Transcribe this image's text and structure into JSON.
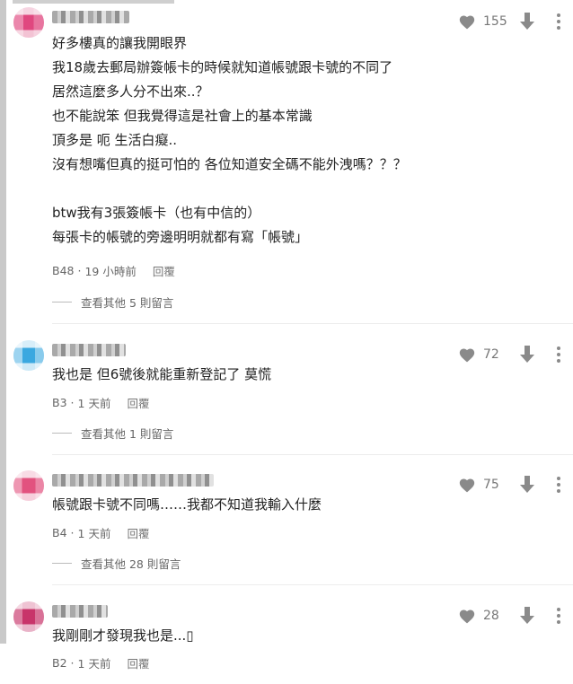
{
  "comments": [
    {
      "likes": "155",
      "lines": [
        "好多樓真的讓我開眼界",
        "我18歲去郵局辦簽帳卡的時候就知道帳號跟卡號的不同了",
        "居然這麼多人分不出來..？",
        "也不能說笨 但我覺得這是社會上的基本常識",
        "頂多是 呃 生活白癡..",
        "沒有想嘴但真的挺可怕的 各位知道安全碼不能外洩嗎？？？",
        "",
        "btw我有3張簽帳卡（也有中信的）",
        "每張卡的帳號的旁邊明明就都有寫「帳號」"
      ],
      "floor": "B48",
      "time": "19 小時前",
      "reply": "回覆",
      "view_more": "查看其他 5 則留言"
    },
    {
      "likes": "72",
      "lines": [
        "我也是 但6號後就能重新登記了 莫慌"
      ],
      "floor": "B3",
      "time": "1 天前",
      "reply": "回覆",
      "view_more": "查看其他 1 則留言"
    },
    {
      "likes": "75",
      "lines": [
        "帳號跟卡號不同嗎……我都不知道我輸入什麼"
      ],
      "floor": "B4",
      "time": "1 天前",
      "reply": "回覆",
      "view_more": "查看其他 28 則留言"
    },
    {
      "likes": "28",
      "lines": [
        "我剛剛才發現我也是...▯"
      ],
      "floor": "B2",
      "time": "1 天前",
      "reply": "回覆"
    }
  ],
  "meta_separator": "·",
  "icons": {
    "like": "heart-icon",
    "dislike": "arrow-down-icon",
    "more": "more-vertical-icon"
  },
  "colors": {
    "icon": "#8a8a8a",
    "text": "#222222",
    "meta": "#666666"
  }
}
